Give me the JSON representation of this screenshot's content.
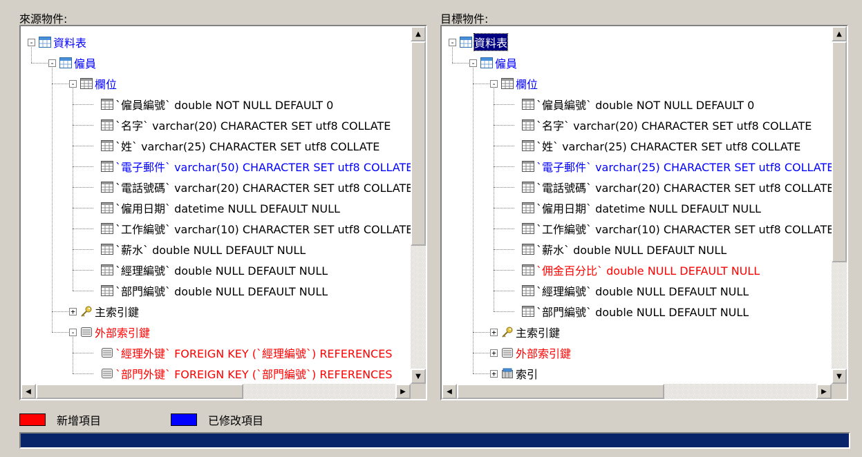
{
  "source": {
    "title": "來源物件:",
    "nodes": [
      {
        "depth": 0,
        "icon": "table",
        "text": "資料表",
        "color": "blue",
        "pm": "-"
      },
      {
        "depth": 1,
        "icon": "table",
        "text": "僱員",
        "color": "blue",
        "pm": "-"
      },
      {
        "depth": 2,
        "icon": "grid",
        "text": "欄位",
        "color": "blue",
        "pm": "-"
      },
      {
        "depth": 3,
        "icon": "grid",
        "text": "`僱員編號` double NOT NULL DEFAULT 0",
        "color": "black"
      },
      {
        "depth": 3,
        "icon": "grid",
        "text": "`名字` varchar(20) CHARACTER SET utf8 COLLATE",
        "color": "black"
      },
      {
        "depth": 3,
        "icon": "grid",
        "text": "`姓` varchar(25) CHARACTER SET utf8 COLLATE",
        "color": "black"
      },
      {
        "depth": 3,
        "icon": "grid",
        "text": "`電子郵件` varchar(50) CHARACTER SET utf8 COLLATE",
        "color": "blue"
      },
      {
        "depth": 3,
        "icon": "grid",
        "text": "`電話號碼` varchar(20) CHARACTER SET utf8 COLLATE",
        "color": "black"
      },
      {
        "depth": 3,
        "icon": "grid",
        "text": "`僱用日期` datetime NULL DEFAULT NULL",
        "color": "black"
      },
      {
        "depth": 3,
        "icon": "grid",
        "text": "`工作編號` varchar(10) CHARACTER SET utf8 COLLATE",
        "color": "black"
      },
      {
        "depth": 3,
        "icon": "grid",
        "text": "`薪水` double NULL DEFAULT NULL",
        "color": "black"
      },
      {
        "depth": 3,
        "icon": "grid",
        "text": "`經理編號` double NULL DEFAULT NULL",
        "color": "black"
      },
      {
        "depth": 3,
        "icon": "grid",
        "text": "`部門編號` double NULL DEFAULT NULL",
        "color": "black"
      },
      {
        "depth": 2,
        "icon": "key",
        "text": "主索引鍵",
        "color": "black",
        "pm": "+"
      },
      {
        "depth": 2,
        "icon": "fk",
        "text": "外部索引鍵",
        "color": "red",
        "pm": "-"
      },
      {
        "depth": 3,
        "icon": "fk",
        "text": "`經理外键` FOREIGN KEY (`經理編號`) REFERENCES",
        "color": "red"
      },
      {
        "depth": 3,
        "icon": "fk",
        "text": "`部門外键` FOREIGN KEY (`部門編號`) REFERENCES",
        "color": "red"
      }
    ]
  },
  "target": {
    "title": "目標物件:",
    "nodes": [
      {
        "depth": 0,
        "icon": "table",
        "text": "資料表",
        "color": "black",
        "pm": "-",
        "selected": true
      },
      {
        "depth": 1,
        "icon": "table",
        "text": "僱員",
        "color": "blue",
        "pm": "-"
      },
      {
        "depth": 2,
        "icon": "grid",
        "text": "欄位",
        "color": "blue",
        "pm": "-"
      },
      {
        "depth": 3,
        "icon": "grid",
        "text": "`僱員編號` double NOT NULL DEFAULT 0",
        "color": "black"
      },
      {
        "depth": 3,
        "icon": "grid",
        "text": "`名字` varchar(20) CHARACTER SET utf8 COLLATE",
        "color": "black"
      },
      {
        "depth": 3,
        "icon": "grid",
        "text": "`姓` varchar(25) CHARACTER SET utf8 COLLATE",
        "color": "black"
      },
      {
        "depth": 3,
        "icon": "grid",
        "text": "`電子郵件` varchar(25) CHARACTER SET utf8 COLLATE",
        "color": "blue"
      },
      {
        "depth": 3,
        "icon": "grid",
        "text": "`電話號碼` varchar(20) CHARACTER SET utf8 COLLATE",
        "color": "black"
      },
      {
        "depth": 3,
        "icon": "grid",
        "text": "`僱用日期` datetime NULL DEFAULT NULL",
        "color": "black"
      },
      {
        "depth": 3,
        "icon": "grid",
        "text": "`工作編號` varchar(10) CHARACTER SET utf8 COLLATE",
        "color": "black"
      },
      {
        "depth": 3,
        "icon": "grid",
        "text": "`薪水` double NULL DEFAULT NULL",
        "color": "black"
      },
      {
        "depth": 3,
        "icon": "grid",
        "text": "`佣金百分比` double NULL DEFAULT NULL",
        "color": "red"
      },
      {
        "depth": 3,
        "icon": "grid",
        "text": "`經理編號` double NULL DEFAULT NULL",
        "color": "black"
      },
      {
        "depth": 3,
        "icon": "grid",
        "text": "`部門編號` double NULL DEFAULT NULL",
        "color": "black"
      },
      {
        "depth": 2,
        "icon": "key",
        "text": "主索引鍵",
        "color": "black",
        "pm": "+"
      },
      {
        "depth": 2,
        "icon": "fk",
        "text": "外部索引鍵",
        "color": "red",
        "pm": "+"
      },
      {
        "depth": 2,
        "icon": "index",
        "text": "索引",
        "color": "black",
        "pm": "+"
      }
    ]
  },
  "legend": {
    "added_label": "新增項目",
    "modified_label": "已修改項目",
    "added_color": "#ff0000",
    "modified_color": "#0000ff"
  },
  "progress": {
    "fraction": 1.0,
    "color": "#0a246a"
  }
}
